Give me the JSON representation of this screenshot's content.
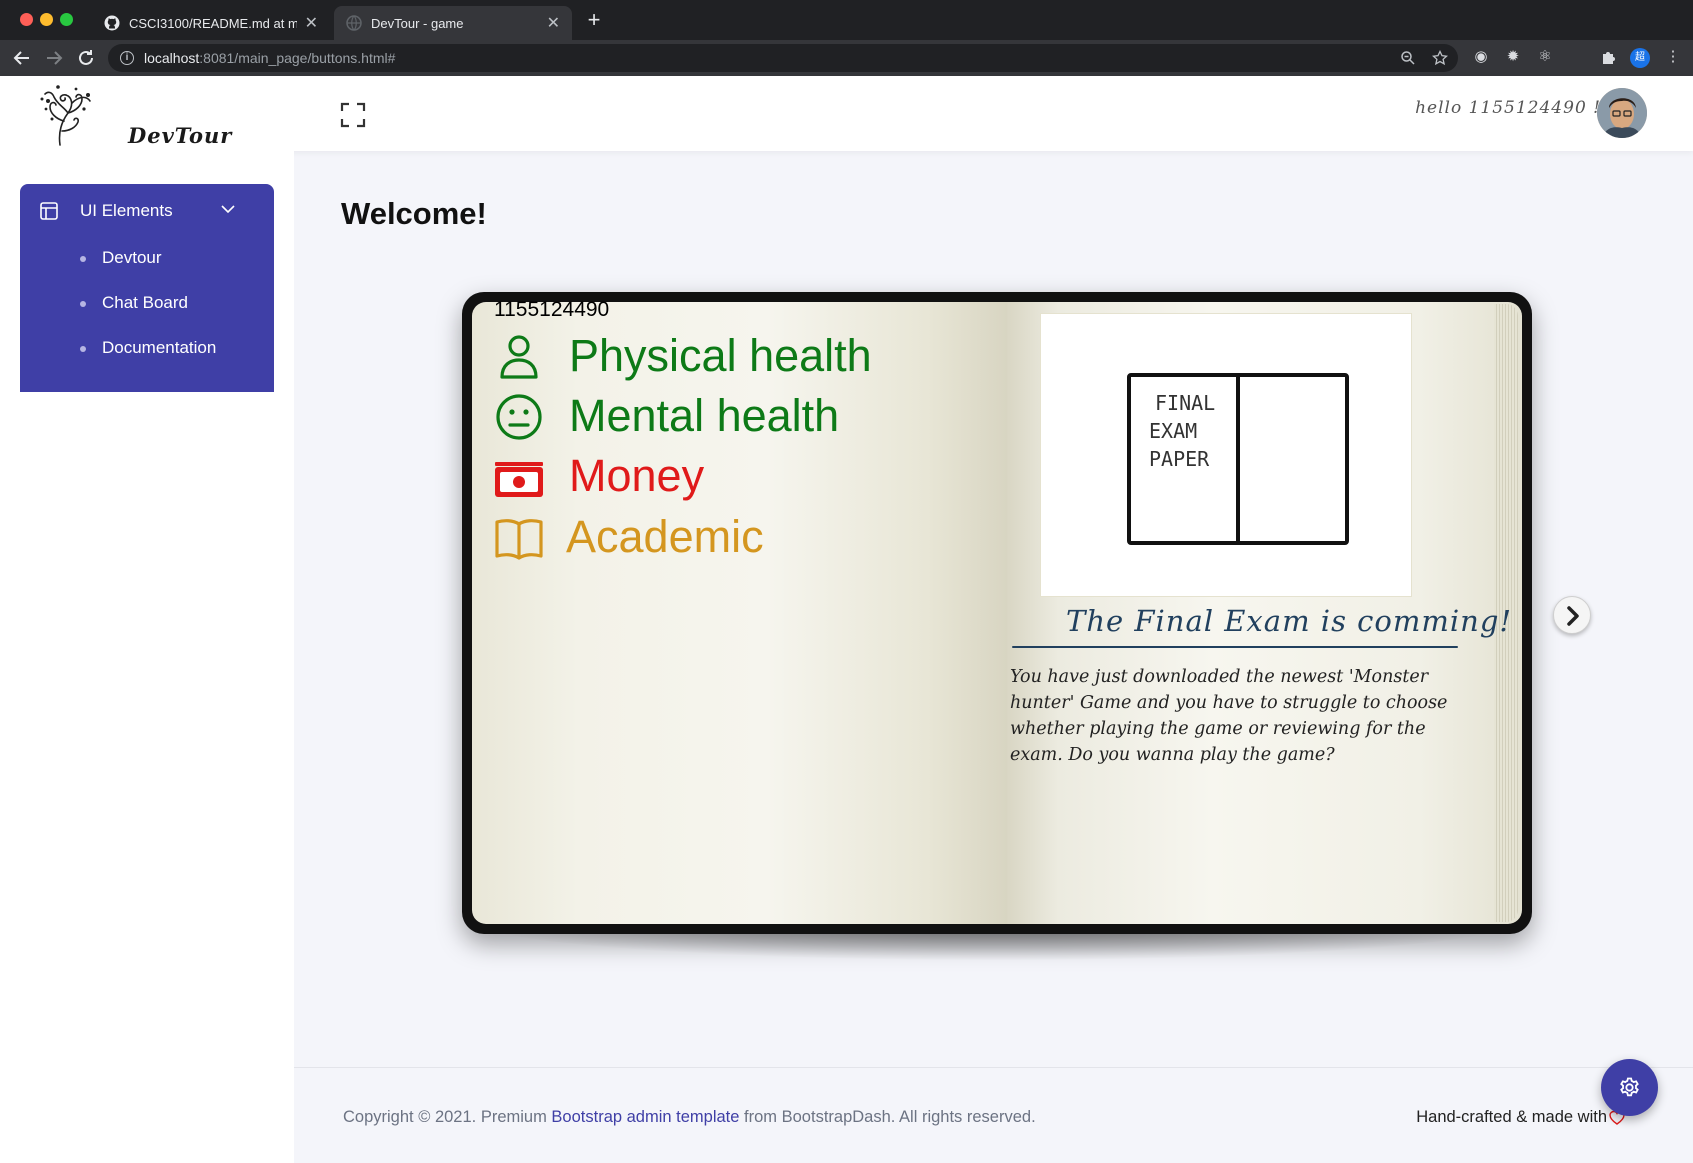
{
  "browser": {
    "tabs": [
      {
        "title": "CSCI3100/README.md at mas",
        "icon": "github-icon"
      },
      {
        "title": "DevTour - game",
        "icon": "globe-icon"
      }
    ],
    "url_host": "localhost",
    "url_rest": ":8081/main_page/buttons.html#",
    "new_tab": "+"
  },
  "navbar": {
    "logo_text": "DevTour",
    "greeting": "hello 1155124490 !"
  },
  "sidebar": {
    "section_label": "UI Elements",
    "items": [
      {
        "label": "Devtour"
      },
      {
        "label": "Chat Board"
      },
      {
        "label": "Documentation"
      }
    ]
  },
  "main": {
    "heading": "Welcome!"
  },
  "game": {
    "player_id": "1155124490",
    "stats": [
      {
        "label": "Physical health",
        "icon": "person-icon",
        "color": "#0d7a17"
      },
      {
        "label": "Mental health",
        "icon": "neutral-face-icon",
        "color": "#0d7a17"
      },
      {
        "label": "Money",
        "icon": "banknote-icon",
        "color": "#e01a1a"
      },
      {
        "label": "Academic",
        "icon": "open-book-icon",
        "color": "#d4961f"
      }
    ],
    "event": {
      "paper_text": [
        "FINAL",
        "EXAM",
        "PAPER"
      ],
      "title": "The Final Exam is comming!",
      "description": "You have just downloaded the newest 'Monster hunter' Game and you have to struggle to choose whether playing the game or reviewing for the exam. Do you wanna play the game?"
    }
  },
  "footer": {
    "copyright_prefix": "Copyright © 2021. Premium ",
    "copyright_link": "Bootstrap admin template",
    "copyright_suffix": " from BootstrapDash. All rights reserved.",
    "handcrafted": "Hand-crafted & made with"
  },
  "colors": {
    "accent": "#3f3fa6",
    "healthy": "#0d7a17",
    "money": "#e01a1a",
    "academic": "#d4961f",
    "exam_title": "#21405e"
  }
}
